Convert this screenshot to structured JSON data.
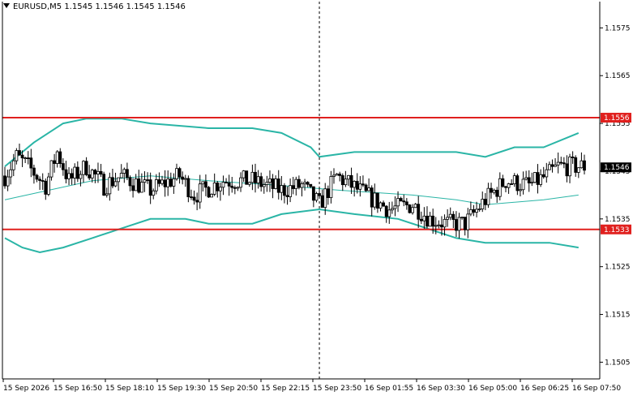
{
  "chart_data": {
    "type": "candlestick",
    "title": "EURUSD,M5",
    "ohlc_header": "1.1545 1.1546 1.1545 1.1546",
    "y_ticks": [
      "1.1575",
      "1.1565",
      "1.1555",
      "1.1545",
      "1.1535",
      "1.1525",
      "1.1515",
      "1.1505"
    ],
    "y_tick_values": [
      1.1575,
      1.1565,
      1.1555,
      1.1545,
      1.1535,
      1.1525,
      1.1515,
      1.1505
    ],
    "x_ticks": [
      "15 Sep 2026",
      "15 Sep 16:50",
      "15 Sep 18:10",
      "15 Sep 19:30",
      "15 Sep 20:50",
      "15 Sep 22:15",
      "15 Sep 23:50",
      "16 Sep 01:55",
      "16 Sep 03:30",
      "16 Sep 05:00",
      "16 Sep 06:25",
      "16 Sep 07:50"
    ],
    "ylim": [
      1.15015,
      1.15805
    ],
    "grid": false,
    "candle_count": 200,
    "current_price_label": "1.1546",
    "current_price": 1.15458,
    "horizontal_levels": [
      {
        "label": "1.1556",
        "value": 1.15562,
        "color": "#e0201e"
      },
      {
        "label": "1.1533",
        "value": 1.15328,
        "color": "#e0201e"
      }
    ],
    "vertical_marker_index": 108,
    "bollinger": {
      "color": "#2ab5a6",
      "upper": [
        [
          0,
          1.1546
        ],
        [
          10,
          1.1551
        ],
        [
          20,
          1.1555
        ],
        [
          28,
          1.1556
        ],
        [
          40,
          1.1556
        ],
        [
          50,
          1.1555
        ],
        [
          70,
          1.1554
        ],
        [
          85,
          1.1554
        ],
        [
          95,
          1.1553
        ],
        [
          105,
          1.155
        ],
        [
          108,
          1.1548
        ],
        [
          120,
          1.1549
        ],
        [
          140,
          1.1549
        ],
        [
          155,
          1.1549
        ],
        [
          165,
          1.1548
        ],
        [
          175,
          1.155
        ],
        [
          185,
          1.155
        ],
        [
          197,
          1.1553
        ]
      ],
      "middle": [
        [
          0,
          1.1539
        ],
        [
          15,
          1.1541
        ],
        [
          30,
          1.1543
        ],
        [
          50,
          1.1544
        ],
        [
          70,
          1.1543
        ],
        [
          95,
          1.1542
        ],
        [
          115,
          1.1541
        ],
        [
          140,
          1.154
        ],
        [
          155,
          1.1539
        ],
        [
          165,
          1.1538
        ],
        [
          185,
          1.1539
        ],
        [
          197,
          1.154
        ]
      ],
      "lower": [
        [
          0,
          1.1531
        ],
        [
          6,
          1.1529
        ],
        [
          12,
          1.1528
        ],
        [
          20,
          1.1529
        ],
        [
          30,
          1.1531
        ],
        [
          40,
          1.1533
        ],
        [
          50,
          1.1535
        ],
        [
          62,
          1.1535
        ],
        [
          70,
          1.1534
        ],
        [
          85,
          1.1534
        ],
        [
          95,
          1.1536
        ],
        [
          108,
          1.1537
        ],
        [
          120,
          1.1536
        ],
        [
          135,
          1.1535
        ],
        [
          145,
          1.1533
        ],
        [
          155,
          1.1531
        ],
        [
          165,
          1.153
        ],
        [
          175,
          1.153
        ],
        [
          187,
          1.153
        ],
        [
          197,
          1.1529
        ]
      ]
    },
    "price_path": [
      [
        0,
        1.1544
      ],
      [
        4,
        1.1548
      ],
      [
        8,
        1.1546
      ],
      [
        14,
        1.1542
      ],
      [
        18,
        1.1549
      ],
      [
        22,
        1.1543
      ],
      [
        28,
        1.1546
      ],
      [
        34,
        1.1542
      ],
      [
        40,
        1.1544
      ],
      [
        50,
        1.1541
      ],
      [
        60,
        1.1544
      ],
      [
        65,
        1.154
      ],
      [
        75,
        1.1543
      ],
      [
        85,
        1.1543
      ],
      [
        95,
        1.1541
      ],
      [
        102,
        1.1542
      ],
      [
        108,
        1.1538
      ],
      [
        114,
        1.1544
      ],
      [
        124,
        1.154
      ],
      [
        132,
        1.1537
      ],
      [
        140,
        1.1538
      ],
      [
        146,
        1.1535
      ],
      [
        152,
        1.1534
      ],
      [
        158,
        1.1534
      ],
      [
        165,
        1.1539
      ],
      [
        172,
        1.1543
      ],
      [
        180,
        1.1542
      ],
      [
        186,
        1.1544
      ],
      [
        190,
        1.1546
      ],
      [
        195,
        1.1546
      ]
    ],
    "candle_noise": 0.00026
  }
}
